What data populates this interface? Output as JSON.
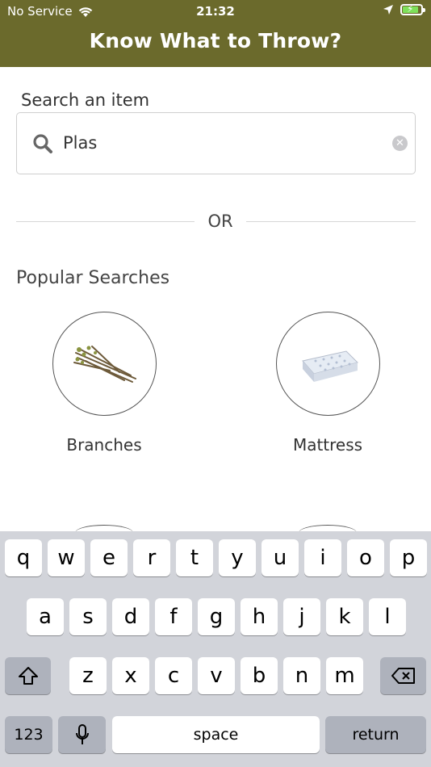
{
  "status_bar": {
    "carrier": "No Service",
    "time": "21:32",
    "wifi_icon": "wifi-icon",
    "location_icon": "location-arrow-icon",
    "battery_icon": "battery-charging-icon"
  },
  "header": {
    "title": "Know What to Throw?",
    "color": "#6b6a2c"
  },
  "search": {
    "label": "Search an item",
    "value": "Plas",
    "placeholder": "",
    "icon": "search-icon",
    "clear_icon": "clear-icon"
  },
  "divider": {
    "text": "OR"
  },
  "popular": {
    "title": "Popular Searches",
    "items": [
      {
        "label": "Branches",
        "icon": "branches-image"
      },
      {
        "label": "Mattress",
        "icon": "mattress-image"
      }
    ]
  },
  "keyboard": {
    "row1": [
      "q",
      "w",
      "e",
      "r",
      "t",
      "y",
      "u",
      "i",
      "o",
      "p"
    ],
    "row2": [
      "a",
      "s",
      "d",
      "f",
      "g",
      "h",
      "j",
      "k",
      "l"
    ],
    "row3": [
      "z",
      "x",
      "c",
      "v",
      "b",
      "n",
      "m"
    ],
    "shift_icon": "shift-icon",
    "delete_icon": "backspace-icon",
    "numbers_label": "123",
    "mic_icon": "microphone-icon",
    "space_label": "space",
    "return_label": "return"
  }
}
